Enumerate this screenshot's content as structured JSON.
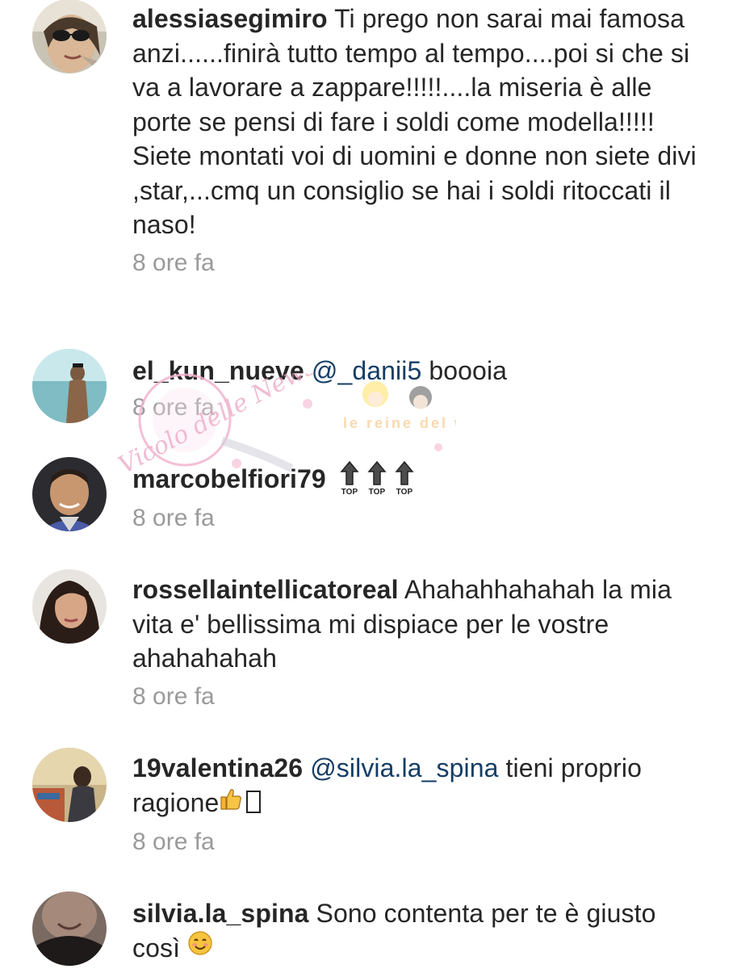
{
  "comments": [
    {
      "username": "alessiasegimiro",
      "text": "Ti prego non sarai mai famosa anzi......finirà tutto tempo al tempo....poi si che si va a lavorare  a zappare!!!!!....la miseria è alle porte se pensi di fare i soldi come modella!!!!! Siete montati voi di uomini e donne non siete divi ,star,...cmq un consiglio se hai i soldi ritoccati il naso!",
      "time": "8 ore fa"
    },
    {
      "username": "el_kun_nueve",
      "mention": "@_danii5",
      "text": "boooia",
      "time": "8 ore fa"
    },
    {
      "username": "marcobelfiori79",
      "arrow_label": "TOP",
      "time": "8 ore fa"
    },
    {
      "username": "rossellaintellicatoreal",
      "text": "Ahahahhahahah la mia vita e' bellissima mi dispiace per le vostre ahahahahah",
      "time": "8 ore fa"
    },
    {
      "username": "19valentina26",
      "mention": "@silvia.la_spina",
      "text": "tieni proprio ragione",
      "time": "8 ore fa"
    },
    {
      "username": "silvia.la_spina",
      "text": "Sono contenta per te è giusto così",
      "time": ""
    }
  ],
  "watermark": {
    "left_text": "Vicolo delle News",
    "right_text": "le reine del web"
  },
  "colors": {
    "username": "#262626",
    "mention": "#143d66",
    "time": "#9a9a9a",
    "background": "#ffffff"
  },
  "icons": {
    "top_arrow": "up-arrow-top-icon",
    "thumbs_up": "thumbs-up-emoji-icon",
    "smile": "smiling-face-emoji-icon"
  }
}
